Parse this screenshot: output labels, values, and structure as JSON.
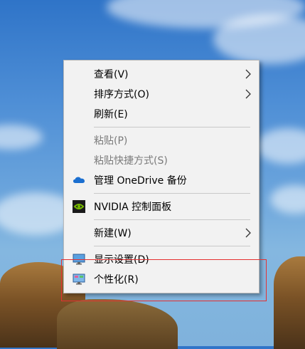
{
  "context_menu": {
    "items": [
      {
        "label": "查看(V)"
      },
      {
        "label": "排序方式(O)"
      },
      {
        "label": "刷新(E)"
      },
      {
        "label": "粘贴(P)"
      },
      {
        "label": "粘贴快捷方式(S)"
      },
      {
        "label": "管理 OneDrive 备份",
        "icon": "onedrive-cloud-icon"
      },
      {
        "label": "NVIDIA 控制面板",
        "icon": "nvidia-icon"
      },
      {
        "label": "新建(W)"
      },
      {
        "label": "显示设置(D)",
        "icon": "display-monitor-icon"
      },
      {
        "label": "个性化(R)",
        "icon": "personalize-monitor-icon"
      }
    ]
  },
  "colors": {
    "menu_bg": "#f2f2f2",
    "disabled_text": "#7a7a7a",
    "highlight_border": "#e53030",
    "onedrive_blue": "#1b6fd0",
    "nvidia_green": "#76b900"
  }
}
